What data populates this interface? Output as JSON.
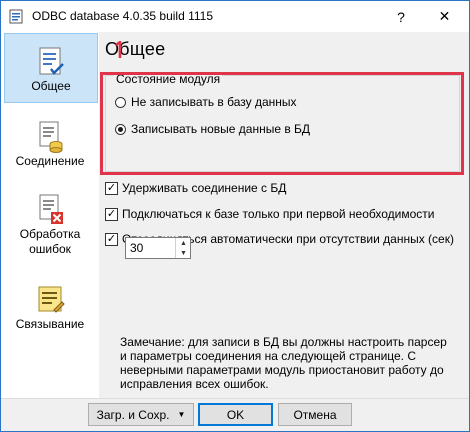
{
  "window": {
    "title": "ODBC database 4.0.35 build 1115",
    "help": "?",
    "close": "✕"
  },
  "sidebar": {
    "items": [
      {
        "label": "Общее",
        "active": true
      },
      {
        "label": "Соединение"
      },
      {
        "label": "Обработка ошибок"
      },
      {
        "label": "Связывание"
      }
    ]
  },
  "main": {
    "title": "Общее",
    "group": {
      "legend": "Состояние модуля",
      "options": [
        {
          "label": "Не записывать в базу данных",
          "selected": false
        },
        {
          "label": "Записывать новые данные в БД",
          "selected": true
        }
      ]
    },
    "checks": [
      {
        "label": "Удерживать соединение с БД",
        "checked": true
      },
      {
        "label": "Подключаться к базе только при первой необходимости",
        "checked": true
      },
      {
        "label": "Отсоединяться автоматически при отсутствии данных (сек)",
        "checked": true
      }
    ],
    "timeout_value": "30",
    "note": "Замечание: для записи в БД вы должны настроить парсер и параметры соединения на следующей странице. С неверными параметрами модуль приостановит работу до исправления всех ошибок."
  },
  "footer": {
    "load_save": "Загр. и Сохр.",
    "ok": "OK",
    "cancel": "Отмена"
  },
  "colors": {
    "highlight": "#e0344a",
    "accent": "#0078d7",
    "selected_bg": "#cce4f7"
  }
}
